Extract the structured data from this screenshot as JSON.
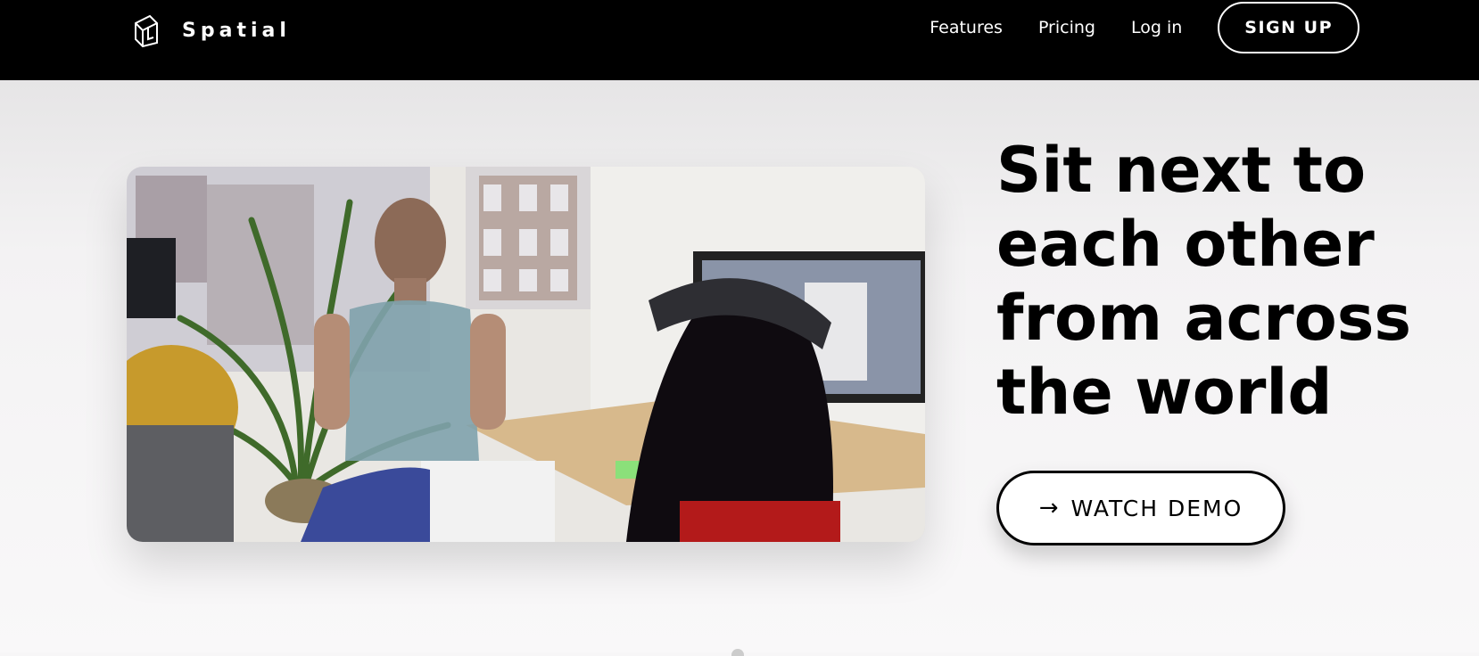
{
  "header": {
    "brand": "Spatial",
    "nav": [
      "Features",
      "Pricing",
      "Log in"
    ],
    "signup_label": "SIGN UP"
  },
  "hero": {
    "headline": "Sit next to each other from across the world",
    "cta_label": "WATCH DEMO",
    "cta_icon": "arrow-right-icon",
    "media_alt": "office scene with a holographic avatar standing beside a desk and a person wearing an AR headset"
  },
  "colors": {
    "header_bg": "#000000",
    "page_bg": "#f7f6f7",
    "text": "#000000"
  }
}
